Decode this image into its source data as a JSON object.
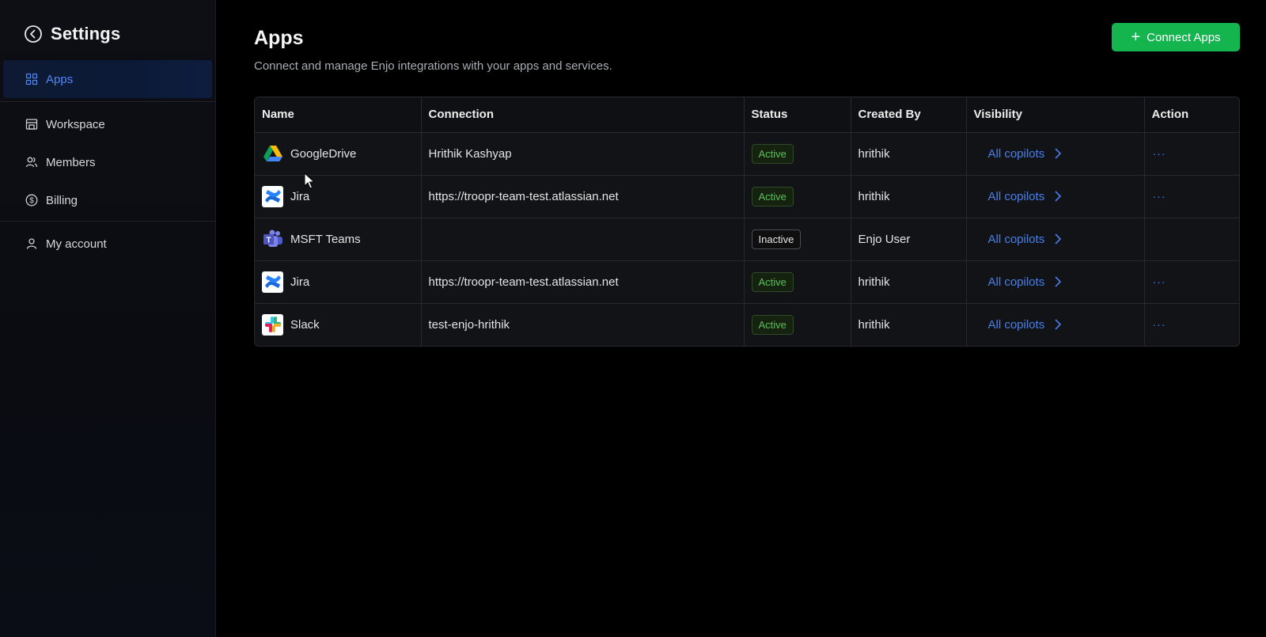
{
  "sidebar": {
    "title": "Settings",
    "items": [
      {
        "label": "Apps",
        "icon": "grid-icon",
        "active": true
      },
      {
        "label": "Workspace",
        "icon": "building-icon"
      },
      {
        "label": "Members",
        "icon": "members-icon"
      },
      {
        "label": "Billing",
        "icon": "dollar-icon"
      },
      {
        "label": "My account",
        "icon": "user-icon"
      }
    ]
  },
  "header": {
    "title": "Apps",
    "subtitle": "Connect and manage Enjo integrations with your apps and services.",
    "connect_button": "Connect Apps"
  },
  "table": {
    "columns": [
      "Name",
      "Connection",
      "Status",
      "Created By",
      "Visibility",
      "Action"
    ],
    "rows": [
      {
        "name": "GoogleDrive",
        "logo": "google-drive-icon",
        "connection": "Hrithik Kashyap",
        "status": "Active",
        "created_by": "hrithik",
        "visibility": "All copilots",
        "action": "···"
      },
      {
        "name": "Jira",
        "logo": "confluence-icon",
        "connection": "https://troopr-team-test.atlassian.net",
        "status": "Active",
        "created_by": "hrithik",
        "visibility": "All copilots",
        "action": "···"
      },
      {
        "name": "MSFT Teams",
        "logo": "ms-teams-icon",
        "connection": "",
        "status": "Inactive",
        "created_by": "Enjo User",
        "visibility": "All copilots",
        "action": ""
      },
      {
        "name": "Jira",
        "logo": "confluence-icon",
        "connection": "https://troopr-team-test.atlassian.net",
        "status": "Active",
        "created_by": "hrithik",
        "visibility": "All copilots",
        "action": "···"
      },
      {
        "name": "Slack",
        "logo": "slack-icon",
        "connection": "test-enjo-hrithik",
        "status": "Active",
        "created_by": "hrithik",
        "visibility": "All copilots",
        "action": "···"
      }
    ]
  },
  "colors": {
    "accent_blue": "#4a7fe6",
    "button_green": "#14b54f",
    "active_green": "#5fbf5c"
  }
}
